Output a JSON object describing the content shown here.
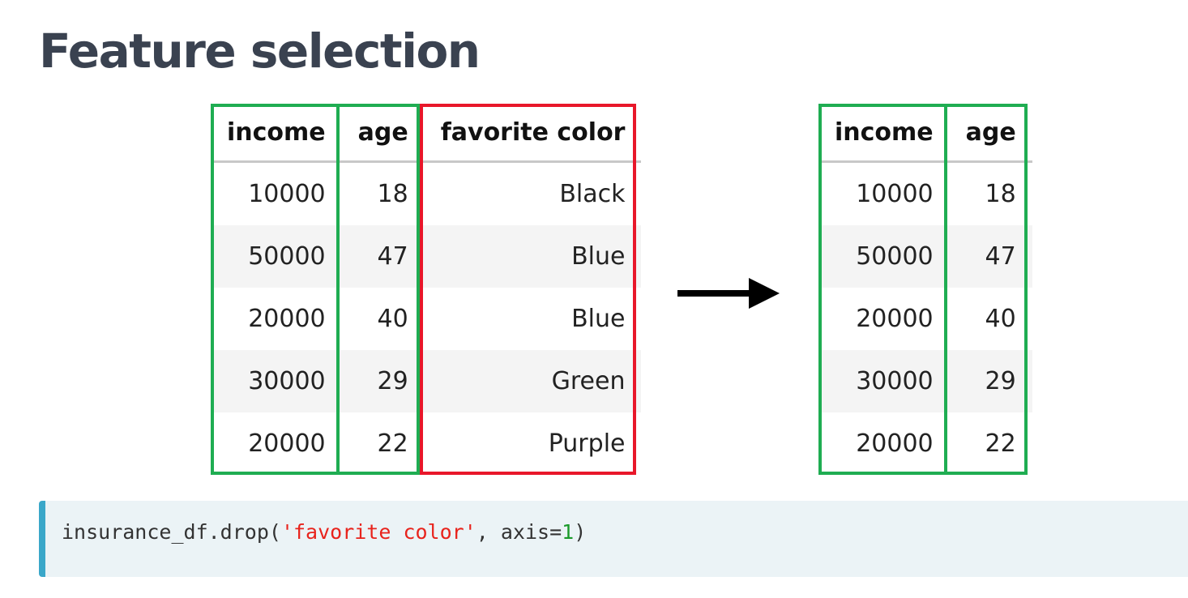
{
  "title": "Feature selection",
  "colors": {
    "kept_outline": "#1fad52",
    "dropped_outline": "#e8172a",
    "code_accent": "#3aa7c9"
  },
  "left_table": {
    "columns": [
      "income",
      "age",
      "favorite color"
    ],
    "rows": [
      [
        "10000",
        "18",
        "Black"
      ],
      [
        "50000",
        "47",
        "Blue"
      ],
      [
        "20000",
        "40",
        "Blue"
      ],
      [
        "30000",
        "29",
        "Green"
      ],
      [
        "20000",
        "22",
        "Purple"
      ]
    ]
  },
  "right_table": {
    "columns": [
      "income",
      "age"
    ],
    "rows": [
      [
        "10000",
        "18"
      ],
      [
        "50000",
        "47"
      ],
      [
        "20000",
        "40"
      ],
      [
        "30000",
        "29"
      ],
      [
        "20000",
        "22"
      ]
    ]
  },
  "arrow_icon": "arrow-right-icon",
  "code": {
    "prefix": "insurance_df.drop(",
    "string_arg": "'favorite color'",
    "middle": ", axis=",
    "number_arg": "1",
    "suffix": ")"
  }
}
